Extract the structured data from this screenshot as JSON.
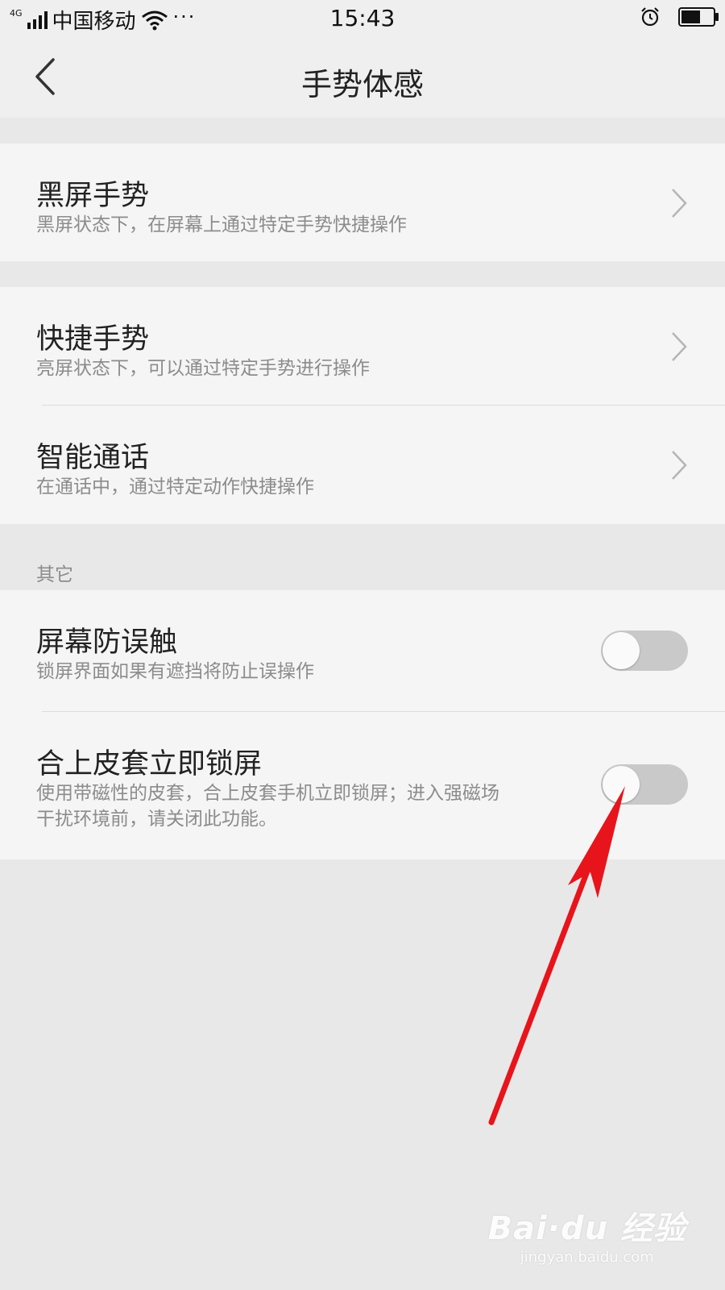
{
  "status_bar": {
    "network": "4G",
    "carrier": "中国移动",
    "more": "···",
    "time": "15:43",
    "battery_level": 0.6
  },
  "header": {
    "title": "手势体感"
  },
  "groups": {
    "screen_off": {
      "title": "黑屏手势",
      "subtitle": "黑屏状态下，在屏幕上通过特定手势快捷操作"
    },
    "quick": {
      "title": "快捷手势",
      "subtitle": "亮屏状态下，可以通过特定手势进行操作"
    },
    "smart_call": {
      "title": "智能通话",
      "subtitle": "在通话中，通过特定动作快捷操作"
    }
  },
  "other_section": {
    "label": "其它",
    "items": [
      {
        "title": "屏幕防误触",
        "subtitle": "锁屏界面如果有遮挡将防止误操作",
        "enabled": false
      },
      {
        "title": "合上皮套立即锁屏",
        "subtitle_line1": "使用带磁性的皮套，合上皮套手机立即锁屏；进入强磁场",
        "subtitle_line2": "干扰环境前，请关闭此功能。",
        "enabled": false
      }
    ]
  },
  "colors": {
    "annotation_arrow": "#e8141b",
    "toggle_off_track": "#c9c9c9"
  },
  "watermark": {
    "logo": "Bai·du 经验",
    "url": "jingyan.baidu.com"
  }
}
